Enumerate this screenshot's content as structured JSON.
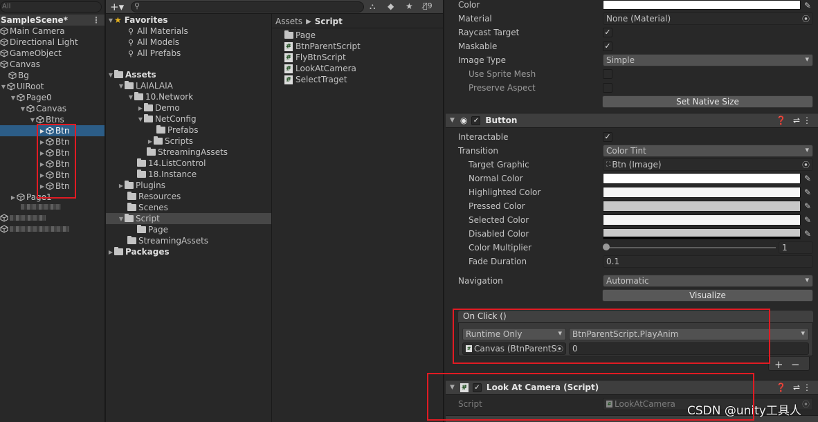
{
  "hierarchy": {
    "search": "All",
    "scene": "SampleScene*",
    "items": [
      "Main Camera",
      "Directional Light",
      "GameObject",
      "Canvas",
      "Bg",
      "UIRoot",
      "Page0",
      "Canvas",
      "Btns",
      "Btn",
      "Btn",
      "Btn",
      "Btn",
      "Btn",
      "Btn",
      "Page1"
    ],
    "hidden_count": "9"
  },
  "project": {
    "favorites": "Favorites",
    "fav_items": [
      "All Materials",
      "All Models",
      "All Prefabs"
    ],
    "assets": "Assets",
    "tree": [
      "LAIALAIA",
      "10.Network",
      "Demo",
      "NetConfig",
      "Prefabs",
      "Scripts",
      "StreamingAssets",
      "14.ListControl",
      "18.Instance",
      "Plugins",
      "Resources",
      "Scenes",
      "Script",
      "Page",
      "StreamingAssets"
    ],
    "packages": "Packages",
    "breadcrumb": [
      "Assets",
      "Script"
    ],
    "files": [
      "Page",
      "BtnParentScript",
      "FlyBtnScript",
      "LookAtCamera",
      "SelectTraget"
    ]
  },
  "inspector": {
    "image": {
      "color_label": "Color",
      "material_label": "Material",
      "material_value": "None (Material)",
      "raycast_label": "Raycast Target",
      "maskable_label": "Maskable",
      "image_type_label": "Image Type",
      "image_type_value": "Simple",
      "use_sprite_mesh_label": "Use Sprite Mesh",
      "preserve_aspect_label": "Preserve Aspect",
      "set_native_size": "Set Native Size"
    },
    "button": {
      "title": "Button",
      "interactable_label": "Interactable",
      "transition_label": "Transition",
      "transition_value": "Color Tint",
      "target_graphic_label": "Target Graphic",
      "target_graphic_value": "Btn (Image)",
      "normal_color_label": "Normal Color",
      "highlighted_color_label": "Highlighted Color",
      "pressed_color_label": "Pressed Color",
      "selected_color_label": "Selected Color",
      "disabled_color_label": "Disabled Color",
      "color_multiplier_label": "Color Multiplier",
      "color_multiplier_value": "1",
      "fade_duration_label": "Fade Duration",
      "fade_duration_value": "0.1",
      "navigation_label": "Navigation",
      "navigation_value": "Automatic",
      "visualize": "Visualize"
    },
    "onclick": {
      "title": "On Click ()",
      "runtime": "Runtime Only",
      "function": "BtnParentScript.PlayAnim",
      "object": "Canvas (BtnParentS",
      "arg": "0",
      "plus": "+",
      "minus": "−"
    },
    "lookat": {
      "title": "Look At Camera (Script)",
      "script_label": "Script",
      "script_value": "LookAtCamera"
    }
  },
  "watermark": "CSDN @unity工具人",
  "colors": {
    "selection": "#2c5d87",
    "highlight_box": "#e11b23"
  }
}
